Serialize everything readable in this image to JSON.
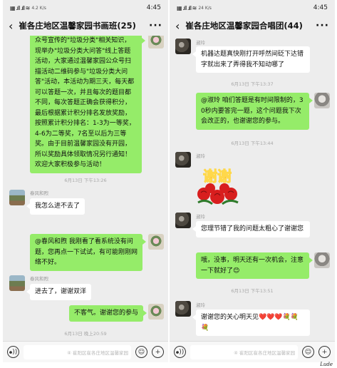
{
  "left": {
    "status": {
      "icons": "▦ .ıll .ıll ≋",
      "speed": "4.2 K/s",
      "time": "4:45"
    },
    "title": "崔各庄地区温馨家园书画班(25)",
    "more": "···",
    "messages": {
      "long": "众号宣传的\"垃圾分类\"相关知识，现举办\"垃圾分类大问答\"线上答题活动，大家通过温馨家园公众号扫描活动二维码参与\"垃圾分类大问答\"活动，本活动为期三天，每天都可以答题一次，并且每次的题目都不同，每次答题正确会获得积分，最后根据累计积分排名发放奖励，按照累计积分排名：1-3为一等奖，4-6为二等奖，7名至以后为三等奖。由于目前温馨家园没有开园，所以奖励具体领取情况另行通知！欢迎大家积极参与活动！",
      "ts1": "6月13日 下午13:26",
      "sender1": "春风和煦",
      "m1": "我怎么进不去了",
      "m2": "@春风和煦 我刚看了看系统没有问题，您再点一下试试，有可能刚刚网络不好。",
      "sender2": "春风和煦",
      "m3": "进去了，谢谢双洋",
      "m4": "不客气。谢谢您的参与",
      "ts2": "6月13日 晚上20:59"
    },
    "watermark": "④ 崔阳区崔各庄地区温馨家园"
  },
  "right": {
    "status": {
      "icons": "▦ .ıll .ıll ≋",
      "speed": "24 K/s",
      "time": "4:45"
    },
    "title": "崔各庄地区温馨家园合唱团(44)",
    "more": "···",
    "messages": {
      "sender1": "淑玲",
      "m1": "机器达题真快刚打开呼然间砭下达错字就出来了弄得我不知动哪了",
      "ts1": "6月13日 下午13:37",
      "m2": "@淑玲  咱们答题是有时间限制的，30秒内要答完一题，这个问题我下次会改正的，也谢谢您的参与。",
      "ts2": "6月13日 下午13:44",
      "sender2": "淑玲",
      "sticker_text": "谢谢",
      "sender3": "淑玲",
      "m3": "您理节错了我的问题太粗心了谢谢您",
      "m4": "哦，没事，明天还有一次机会，注意一下就好了😊",
      "ts3": "6月13日 下午13:51",
      "sender4": "淑玲",
      "m5": "谢谢您的关心明天见❤️❤️❤️💐💐💐"
    },
    "watermark": "④ 崔阳区崔各庄地区温馨家园"
  },
  "corner_logo": "Lude"
}
